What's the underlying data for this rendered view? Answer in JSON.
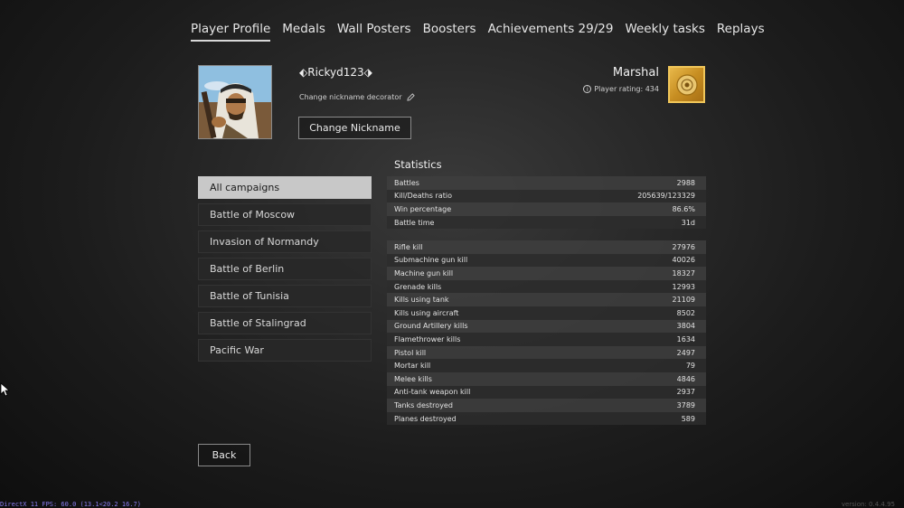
{
  "nav": {
    "tabs": [
      {
        "label": "Player Profile",
        "active": true
      },
      {
        "label": "Medals"
      },
      {
        "label": "Wall Posters"
      },
      {
        "label": "Boosters"
      },
      {
        "label": "Achievements 29/29"
      },
      {
        "label": "Weekly tasks"
      },
      {
        "label": "Replays"
      }
    ]
  },
  "profile": {
    "nickname": "⬖Rickyd123⬗",
    "nickname_decorator_link": "Change nickname decorator",
    "change_nickname_button": "Change Nickname",
    "rank": "Marshal",
    "rating_text": "Player rating: 434",
    "accent_gold": "#d9a434"
  },
  "campaigns": [
    {
      "label": "All campaigns",
      "active": true
    },
    {
      "label": "Battle of Moscow"
    },
    {
      "label": "Invasion of Normandy"
    },
    {
      "label": "Battle of Berlin"
    },
    {
      "label": "Battle of Tunisia"
    },
    {
      "label": "Battle of Stalingrad"
    },
    {
      "label": "Pacific War"
    }
  ],
  "statistics": {
    "title": "Statistics",
    "general": [
      {
        "label": "Battles",
        "value": "2988"
      },
      {
        "label": "Kill/Deaths ratio",
        "value": "205639/123329"
      },
      {
        "label": "Win percentage",
        "value": "86.6%"
      },
      {
        "label": "Battle time",
        "value": "31d"
      }
    ],
    "kills": [
      {
        "label": "Rifle kill",
        "value": "27976"
      },
      {
        "label": "Submachine gun kill",
        "value": "40026"
      },
      {
        "label": "Machine gun kill",
        "value": "18327"
      },
      {
        "label": "Grenade kills",
        "value": "12993"
      },
      {
        "label": "Kills using tank",
        "value": "21109"
      },
      {
        "label": "Kills using aircraft",
        "value": "8502"
      },
      {
        "label": "Ground Artillery kills",
        "value": "3804"
      },
      {
        "label": "Flamethrower kills",
        "value": "1634"
      },
      {
        "label": "Pistol kill",
        "value": "2497"
      },
      {
        "label": "Mortar kill",
        "value": "79"
      },
      {
        "label": "Melee kills",
        "value": "4846"
      },
      {
        "label": "Anti-tank weapon kill",
        "value": "2937"
      },
      {
        "label": "Tanks destroyed",
        "value": "3789"
      },
      {
        "label": "Planes destroyed",
        "value": "589"
      }
    ]
  },
  "back_button": "Back",
  "fps_overlay": "DirectX 11 FPS: 60.0 (13.1<20.2 16.7)",
  "version": "version: 0.4.4.95"
}
